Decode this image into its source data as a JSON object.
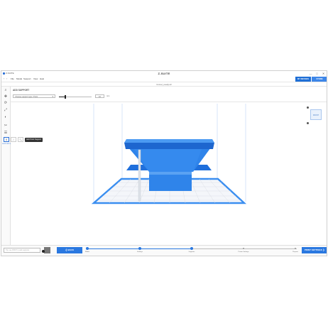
{
  "window": {
    "app_title": "Z-SUITE",
    "brand": "Z-SUITE",
    "controls": [
      "—",
      "□",
      "✕"
    ]
  },
  "menu": {
    "items": [
      "File",
      "Model",
      "Support",
      "View",
      "Help"
    ],
    "back_arrow": "‹",
    "forward_arrow": "›"
  },
  "header_buttons": {
    "my_devices": "MY DEVICES",
    "store": "STORE"
  },
  "file": {
    "name": "funnel_ready.stl"
  },
  "sidebar": {
    "tools": [
      {
        "name": "zoom-icon",
        "glyph": "⌕"
      },
      {
        "name": "move-icon",
        "glyph": "✥"
      },
      {
        "name": "rotate-icon",
        "glyph": "⟳"
      },
      {
        "name": "scale-icon",
        "glyph": "⤢"
      },
      {
        "name": "mirror-icon",
        "glyph": "◐"
      },
      {
        "name": "cut-icon",
        "glyph": "✂"
      },
      {
        "name": "layers-icon",
        "glyph": "☰"
      },
      {
        "name": "support-icon",
        "glyph": "⚲"
      }
    ],
    "active_label": "SUPPORTS"
  },
  "support_panel": {
    "title": "ADD SUPPORT",
    "mode_select": "Choose support type / Point",
    "slider_value": 20,
    "value": "10",
    "unit": "mm",
    "tooltip": "Add Point Support"
  },
  "viewcube": {
    "label": "FRONT"
  },
  "bottom": {
    "notice_placeholder": "Tip: use SHIFT to add supports",
    "back": "❮ BACK",
    "print": "PRINT SETTINGS ❯",
    "steps": [
      {
        "label": "Model",
        "done": true
      },
      {
        "label": "Settings",
        "done": true
      },
      {
        "label": "Supports",
        "done": true
      },
      {
        "label": "Printer Settings",
        "done": false
      },
      {
        "label": "Prepare",
        "done": false
      }
    ]
  },
  "colors": {
    "accent": "#2a78e0",
    "model": "#2f84ea",
    "platform": "#3a8ef0"
  }
}
